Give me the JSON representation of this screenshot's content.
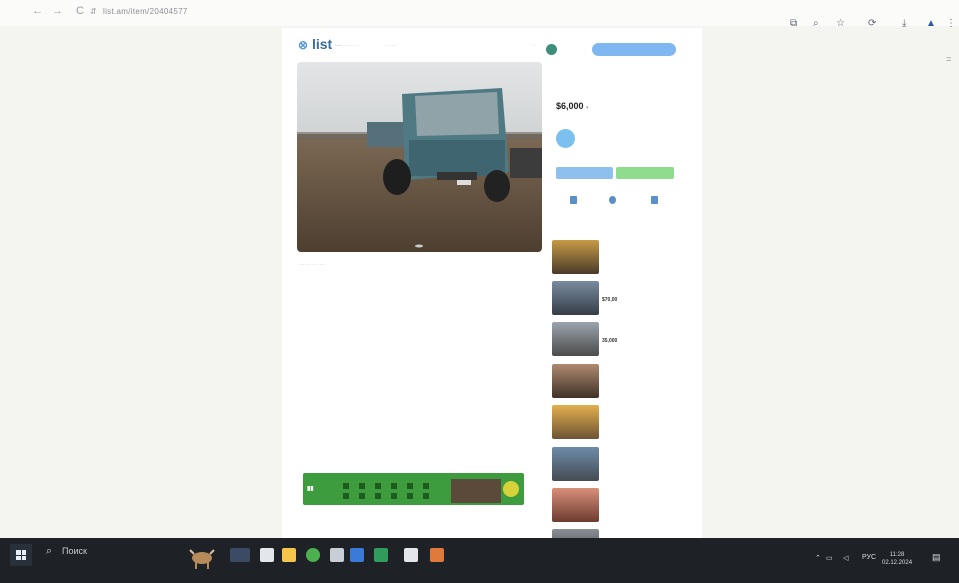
{
  "browser": {
    "address": "list.am/item/20404577",
    "nav": {
      "back": "←",
      "forward": "→",
      "reload": "C"
    }
  },
  "header": {
    "logo_text": "list",
    "post_button": "",
    "user_name": ""
  },
  "listing": {
    "title": "",
    "price": "$6,000",
    "seller_name": "",
    "contact_label": "",
    "chat_label": "",
    "actions": [
      {
        "icon": "heart-icon",
        "label": ""
      },
      {
        "icon": "share-icon",
        "label": ""
      },
      {
        "icon": "flag-icon",
        "label": ""
      }
    ]
  },
  "similar": {
    "heading": "",
    "items": [
      {
        "price": "",
        "color_top": "#c79b45",
        "color_bot": "#4a3a2a"
      },
      {
        "price": "$70,00",
        "color_top": "#7a8ba0",
        "color_bot": "#353d47"
      },
      {
        "price": "35,000",
        "color_top": "#9aa4ad",
        "color_bot": "#4b4b4b"
      },
      {
        "price": "",
        "color_top": "#b08a70",
        "color_bot": "#3f3227"
      },
      {
        "price": "",
        "color_top": "#e2b04d",
        "color_bot": "#6d5333"
      },
      {
        "price": "",
        "color_top": "#6d8ba8",
        "color_bot": "#454b52"
      },
      {
        "price": "",
        "color_top": "#d8907a",
        "color_bot": "#6c3b2f"
      },
      {
        "price": "",
        "color_top": "#8a8f95",
        "color_bot": "#3a3c40"
      }
    ]
  },
  "specs": {
    "heading": "",
    "rows": [
      {
        "k": "",
        "v": ""
      },
      {
        "k": "",
        "v": ""
      },
      {
        "k": "",
        "v": ""
      },
      {
        "k": "",
        "v": ""
      },
      {
        "k": "",
        "v": ""
      },
      {
        "k": "",
        "v": ""
      },
      {
        "k": "",
        "v": ""
      }
    ]
  },
  "extra": {
    "heading": "",
    "rows": [
      {
        "k": "",
        "v": ""
      },
      {
        "k": "",
        "v": ""
      },
      {
        "k": "",
        "v": ""
      }
    ]
  },
  "description": {
    "heading": "",
    "text": ""
  },
  "banner": {
    "text": ""
  },
  "taskbar": {
    "search_label": "Поиск",
    "language": "РУС",
    "time": "11:28",
    "date": "02.12.2024"
  }
}
